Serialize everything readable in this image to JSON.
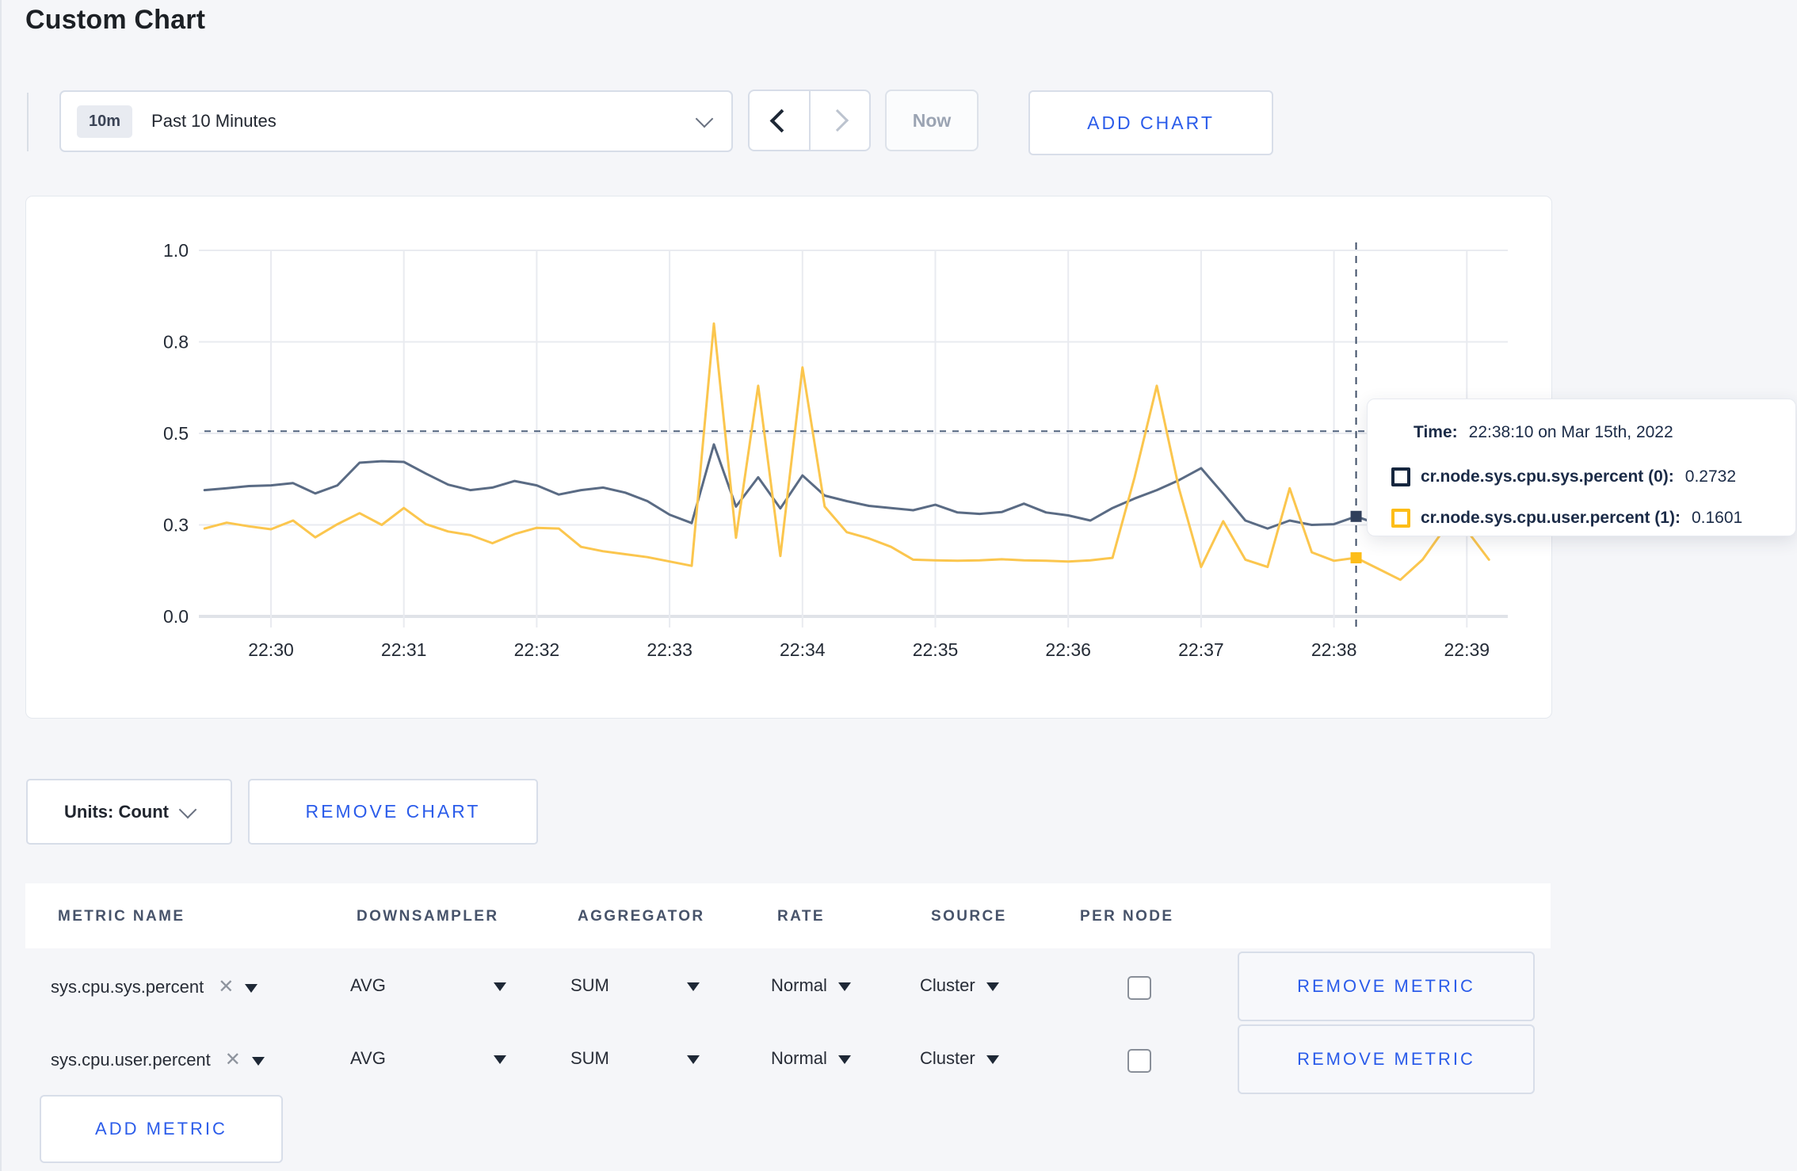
{
  "page": {
    "title": "Custom Chart"
  },
  "toolbar": {
    "range_badge": "10m",
    "range_label": "Past 10 Minutes",
    "now_label": "Now",
    "add_chart_label": "ADD CHART"
  },
  "tooltip": {
    "time_label": "Time:",
    "time_value": "22:38:10 on Mar 15th, 2022",
    "rows": [
      {
        "label": "cr.node.sys.cpu.sys.percent (0):",
        "value": "0.2732",
        "swatch_color": "#16263e"
      },
      {
        "label": "cr.node.sys.cpu.user.percent (1):",
        "value": "0.1601",
        "swatch_color": "#fdbd18"
      }
    ]
  },
  "units_bar": {
    "units_label": "Units: Count",
    "remove_chart_label": "REMOVE CHART"
  },
  "metrics_table": {
    "headers": [
      "METRIC NAME",
      "DOWNSAMPLER",
      "AGGREGATOR",
      "RATE",
      "SOURCE",
      "PER NODE"
    ],
    "rows": [
      {
        "metric": "sys.cpu.sys.percent",
        "downsampler": "AVG",
        "aggregator": "SUM",
        "rate": "Normal",
        "source": "Cluster",
        "per_node_checked": false,
        "remove_label": "REMOVE METRIC"
      },
      {
        "metric": "sys.cpu.user.percent",
        "downsampler": "AVG",
        "aggregator": "SUM",
        "rate": "Normal",
        "source": "Cluster",
        "per_node_checked": false,
        "remove_label": "REMOVE METRIC"
      }
    ],
    "add_metric_label": "ADD METRIC"
  },
  "colors": {
    "accent_blue": "#2b5cea",
    "grid": "#e9ebf0",
    "axis_base": "#e0e3e8",
    "axis_text": "#242b36",
    "crosshair": "#51637e"
  },
  "chart_data": {
    "type": "line",
    "title": "",
    "xlabel": "",
    "ylabel": "",
    "ylim": [
      0,
      1.0
    ],
    "grid": true,
    "legend_position": "tooltip-only",
    "x_ticks": [
      "22:30",
      "22:31",
      "22:32",
      "22:33",
      "22:34",
      "22:35",
      "22:36",
      "22:37",
      "22:38",
      "22:39"
    ],
    "y_ticks": [
      {
        "v": 1.0,
        "label": "1.0"
      },
      {
        "v": 0.75,
        "label": "0.8"
      },
      {
        "v": 0.5,
        "label": "0.5"
      },
      {
        "v": 0.25,
        "label": "0.3"
      },
      {
        "v": 0.0,
        "label": "0.0"
      }
    ],
    "start_time": "22:29:30",
    "interval_seconds": 10,
    "series": [
      {
        "name": "cr.node.sys.cpu.sys.percent",
        "color": "#5a6b84",
        "values": [
          0.345,
          0.35,
          0.356,
          0.358,
          0.364,
          0.336,
          0.358,
          0.42,
          0.424,
          0.422,
          0.39,
          0.36,
          0.345,
          0.352,
          0.37,
          0.358,
          0.333,
          0.345,
          0.352,
          0.338,
          0.315,
          0.278,
          0.255,
          0.47,
          0.3,
          0.38,
          0.295,
          0.385,
          0.33,
          0.315,
          0.302,
          0.296,
          0.29,
          0.305,
          0.284,
          0.28,
          0.285,
          0.308,
          0.284,
          0.276,
          0.262,
          0.296,
          0.322,
          0.345,
          0.372,
          0.405,
          0.335,
          0.262,
          0.24,
          0.262,
          0.25,
          0.252,
          0.2732,
          0.252,
          0.262,
          0.27,
          0.282,
          0.295,
          0.3
        ]
      },
      {
        "name": "cr.node.sys.cpu.user.percent",
        "color": "#fbc64e",
        "values": [
          0.24,
          0.256,
          0.246,
          0.238,
          0.262,
          0.216,
          0.252,
          0.282,
          0.25,
          0.296,
          0.252,
          0.232,
          0.222,
          0.2,
          0.225,
          0.242,
          0.24,
          0.19,
          0.178,
          0.17,
          0.162,
          0.15,
          0.138,
          0.8,
          0.215,
          0.63,
          0.165,
          0.68,
          0.3,
          0.23,
          0.213,
          0.19,
          0.155,
          0.153,
          0.152,
          0.153,
          0.156,
          0.153,
          0.152,
          0.15,
          0.153,
          0.16,
          0.38,
          0.63,
          0.35,
          0.135,
          0.26,
          0.155,
          0.135,
          0.35,
          0.175,
          0.152,
          0.1601,
          0.13,
          0.1,
          0.155,
          0.24,
          0.235,
          0.155
        ]
      }
    ],
    "crosshair": {
      "time": "22:38:10",
      "h_line_value": 0.506,
      "points": [
        {
          "series": 0,
          "value": 0.2732,
          "color": "#31405c"
        },
        {
          "series": 1,
          "value": 0.1601,
          "color": "#fdbd18"
        }
      ]
    }
  }
}
